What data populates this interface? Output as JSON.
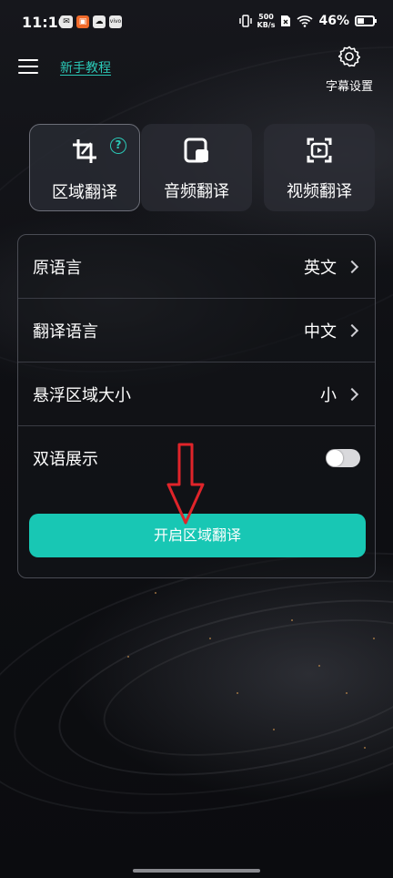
{
  "status_bar": {
    "time": "11:10",
    "net_speed_value": "500",
    "net_speed_unit": "KB/s",
    "battery_label": "46%",
    "battery_level": 0.46,
    "icons": [
      "mail-icon",
      "app-icon",
      "cloud-icon",
      "vivo-icon",
      "vibrate-icon",
      "wifi-icon",
      "sim-icon"
    ]
  },
  "header": {
    "tutorial_label": "新手教程",
    "subtitle_settings_label": "字幕设置"
  },
  "modes": [
    {
      "label": "区域翻译",
      "icon": "crop-icon",
      "active": true
    },
    {
      "label": "音频翻译",
      "icon": "audio-icon",
      "active": false
    },
    {
      "label": "视频翻译",
      "icon": "video-icon",
      "active": false
    }
  ],
  "help_symbol": "?",
  "settings": {
    "rows": [
      {
        "label": "原语言",
        "value": "英文"
      },
      {
        "label": "翻译语言",
        "value": "中文"
      },
      {
        "label": "悬浮区域大小",
        "value": "小"
      }
    ],
    "bilingual_label": "双语展示",
    "bilingual_on": false
  },
  "start_button_label": "开启区域翻译",
  "colors": {
    "accent": "#18c7b4",
    "link": "#2bc9b7",
    "arrow": "#e0242a",
    "background": "#0d0e12"
  }
}
